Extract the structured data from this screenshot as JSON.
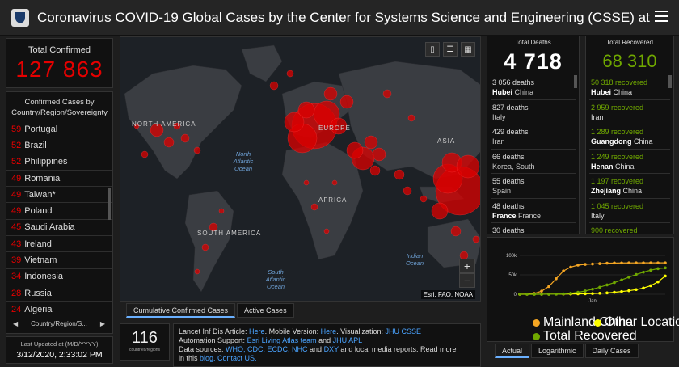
{
  "header": {
    "title": "Coronavirus COVID-19 Global Cases by the Center for Systems Science and Engineering (CSSE) at J…"
  },
  "total_confirmed": {
    "label": "Total Confirmed",
    "value": "127 863"
  },
  "country_list": {
    "header": "Confirmed Cases by Country/Region/Sovereignty",
    "rows": [
      {
        "n": "59",
        "c": "Portugal"
      },
      {
        "n": "52",
        "c": "Brazil"
      },
      {
        "n": "52",
        "c": "Philippines"
      },
      {
        "n": "49",
        "c": "Romania"
      },
      {
        "n": "49",
        "c": "Taiwan*"
      },
      {
        "n": "49",
        "c": "Poland"
      },
      {
        "n": "45",
        "c": "Saudi Arabia"
      },
      {
        "n": "43",
        "c": "Ireland"
      },
      {
        "n": "39",
        "c": "Vietnam"
      },
      {
        "n": "34",
        "c": "Indonesia"
      },
      {
        "n": "28",
        "c": "Russia"
      },
      {
        "n": "24",
        "c": "Algeria"
      }
    ],
    "footer": "Country/Region/S..."
  },
  "last_updated": {
    "label": "Last Updated at (M/D/YYYY)",
    "value": "3/12/2020, 2:33:02 PM"
  },
  "map": {
    "labels": {
      "na": "NORTH AMERICA",
      "sa": "SOUTH AMERICA",
      "eu": "EUROPE",
      "af": "AFRICA",
      "as": "ASIA"
    },
    "oceans": {
      "natl": "North Atlantic Ocean",
      "satl": "South Atlantic Ocean",
      "ind": "Indian Ocean"
    },
    "attribution": "Esri, FAO, NOAA",
    "tabs": [
      "Cumulative Confirmed Cases",
      "Active Cases"
    ]
  },
  "count_box": {
    "value": "116",
    "sub": "countries/regions"
  },
  "info": {
    "line1_pre": "Lancet Inf Dis Article: ",
    "line1_link1": "Here",
    "line1_mid": ". Mobile Version: ",
    "line1_link2": "Here",
    "line1_mid2": ". Visualization: ",
    "line1_link3": "JHU CSSE",
    "line2_pre": "Automation Support: ",
    "line2_link1": "Esri Living Atlas team",
    "line2_mid": " and ",
    "line2_link2": "JHU APL",
    "line3_pre": "Data sources: ",
    "line3_links": "WHO, CDC, ECDC, NHC",
    "line3_mid": " and ",
    "line3_link2": "DXY",
    "line3_post": " and local media reports. Read more",
    "line4_pre": "in this ",
    "line4_link": "blog. Contact US."
  },
  "deaths": {
    "label": "Total Deaths",
    "value": "4 718",
    "rows": [
      {
        "a": "3 056 deaths",
        "b_bold": "Hubei",
        "b": " China"
      },
      {
        "a": "827 deaths",
        "b_bold": "",
        "b": "Italy"
      },
      {
        "a": "429 deaths",
        "b_bold": "",
        "b": "Iran"
      },
      {
        "a": "66 deaths",
        "b_bold": "",
        "b": "Korea, South"
      },
      {
        "a": "55 deaths",
        "b_bold": "",
        "b": "Spain"
      },
      {
        "a": "48 deaths",
        "b_bold": "France",
        "b": " France"
      },
      {
        "a": "30 deaths",
        "b_bold": "",
        "b": ""
      }
    ]
  },
  "recovered": {
    "label": "Total Recovered",
    "value": "68 310",
    "rows": [
      {
        "a": "50 318 recovered",
        "b_bold": "Hubei",
        "b": " China"
      },
      {
        "a": "2 959 recovered",
        "b_bold": "",
        "b": "Iran"
      },
      {
        "a": "1 289 recovered",
        "b_bold": "Guangdong",
        "b": " China"
      },
      {
        "a": "1 249 recovered",
        "b_bold": "Henan",
        "b": " China"
      },
      {
        "a": "1 197 recovered",
        "b_bold": "Zhejiang",
        "b": " China"
      },
      {
        "a": "1 045 recovered",
        "b_bold": "",
        "b": "Italy"
      },
      {
        "a": "900 recovered",
        "b_bold": "",
        "b": ""
      }
    ]
  },
  "chart_data": {
    "type": "line",
    "yticks": [
      "100k",
      "50k",
      "0"
    ],
    "xlabel": "Jan",
    "ylim": [
      0,
      100000
    ],
    "x": [
      0,
      1,
      2,
      3,
      4,
      5,
      6,
      7,
      8,
      9,
      10,
      11,
      12,
      13,
      14,
      15,
      16,
      17,
      18,
      19,
      20
    ],
    "series": [
      {
        "name": "Mainland China",
        "color": "#f5a623",
        "values": [
          0,
          500,
          2000,
          8000,
          20000,
          40000,
          60000,
          70000,
          75000,
          77000,
          78000,
          79000,
          80000,
          80500,
          80700,
          80800,
          80900,
          80950,
          81000,
          81000,
          81000
        ]
      },
      {
        "name": "Other Locations",
        "color": "#ffff00",
        "values": [
          0,
          0,
          0,
          100,
          200,
          300,
          500,
          700,
          1000,
          1300,
          1800,
          2500,
          3500,
          5000,
          7000,
          9000,
          12000,
          16000,
          22000,
          32000,
          47000
        ]
      },
      {
        "name": "Total Recovered",
        "color": "#70a800",
        "values": [
          0,
          0,
          0,
          0,
          100,
          300,
          1000,
          2500,
          5000,
          8500,
          13000,
          18000,
          24000,
          30000,
          37000,
          44000,
          51000,
          57000,
          62000,
          66000,
          68000
        ]
      }
    ],
    "tabs": [
      "Actual",
      "Logarithmic",
      "Daily Cases"
    ]
  }
}
